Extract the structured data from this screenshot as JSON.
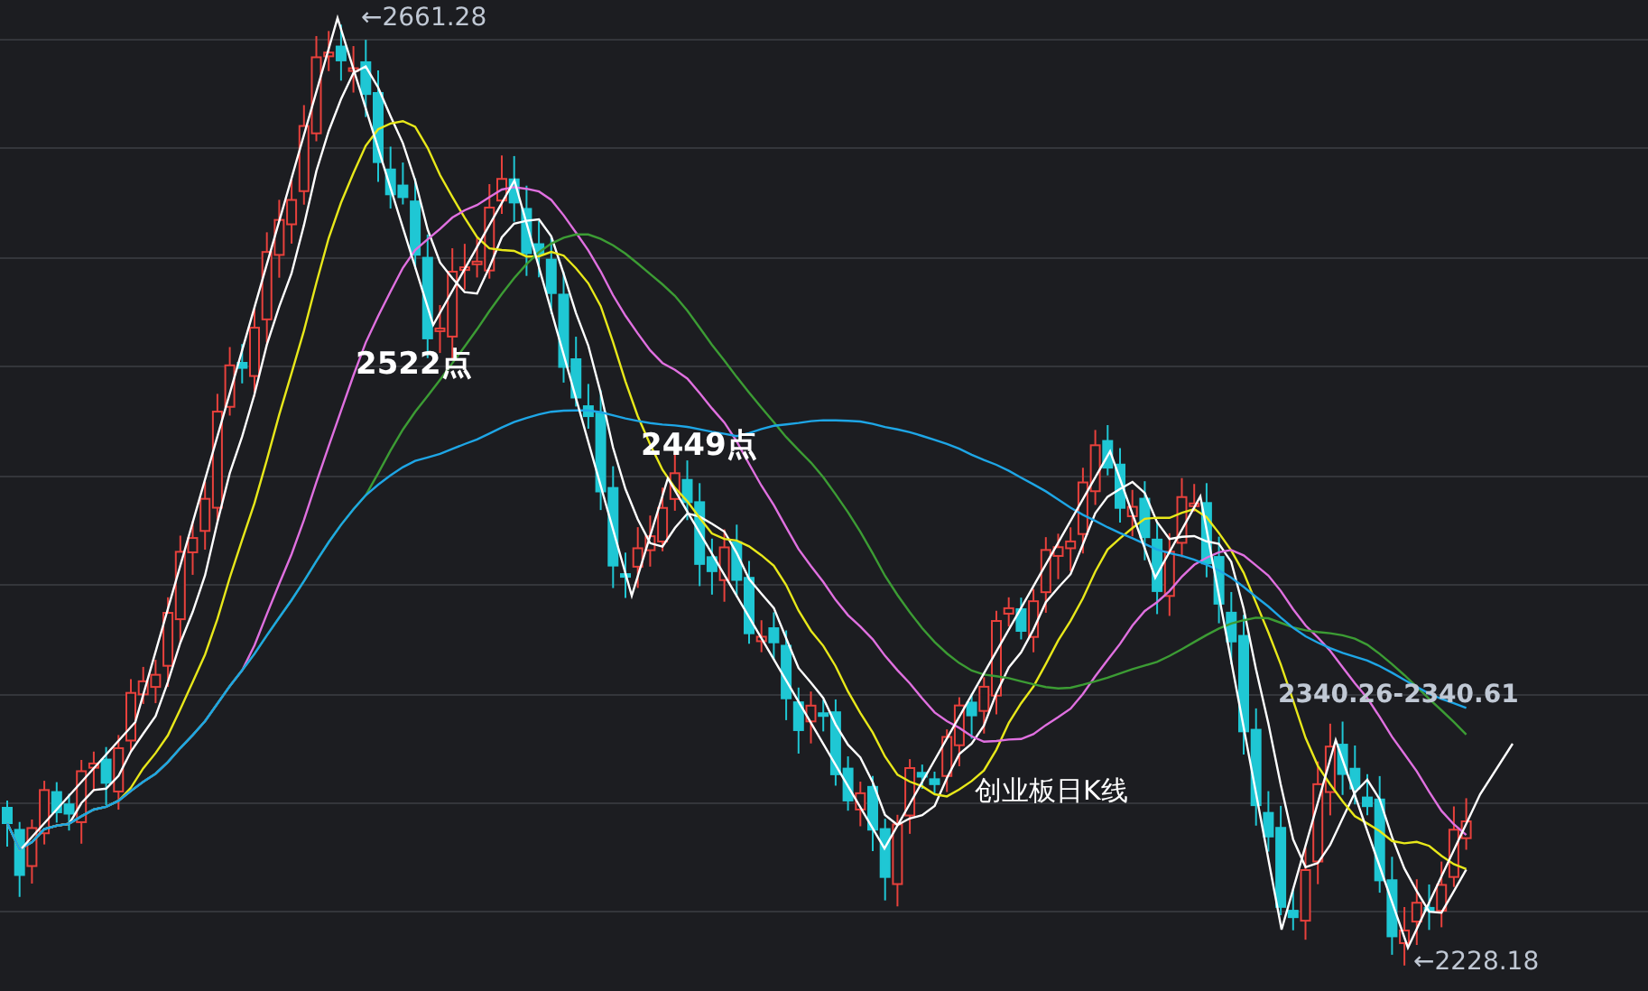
{
  "chart": {
    "title": "创业板日K线",
    "annotations": [
      {
        "kind": "arrow",
        "text": "←2661.28"
      },
      {
        "kind": "plain",
        "text": "2522点"
      },
      {
        "kind": "plain",
        "text": "2449点"
      },
      {
        "kind": "plain",
        "text": "2340.26-2340.61"
      },
      {
        "kind": "arrow",
        "text": "←2228.18"
      }
    ]
  }
}
